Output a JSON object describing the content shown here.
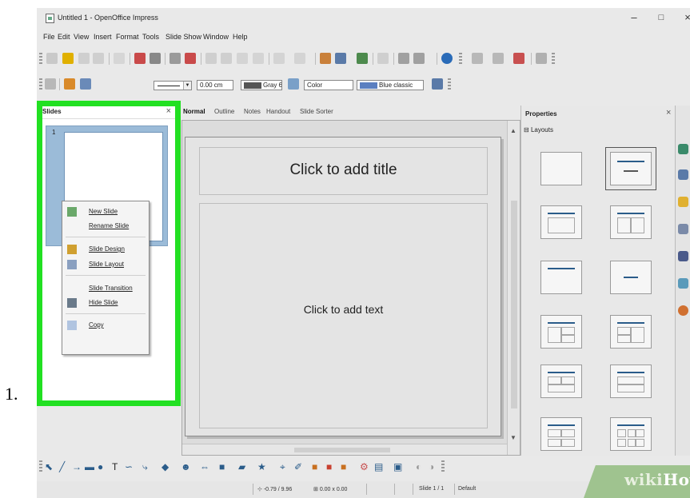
{
  "step_number": "1.",
  "window": {
    "title": "Untitled 1 - OpenOffice Impress",
    "minimize": "–",
    "maximize": "□",
    "close": "×"
  },
  "menu": [
    "File",
    "Edit",
    "View",
    "Insert",
    "Format",
    "Tools",
    "Slide Show",
    "Window",
    "Help"
  ],
  "line_toolbar": {
    "line_width": "0.00 cm",
    "line_color": "Gray 6",
    "area_style": "Color",
    "area_color": "Blue classic",
    "colors": {
      "gray": "#555555",
      "blue": "#5b7fc0"
    }
  },
  "slides_pane": {
    "title": "Slides",
    "close": "×",
    "slide_number": "1",
    "highlight_color": "#22e022"
  },
  "context_menu": {
    "items": [
      {
        "label": "New Slide",
        "icon": "new-slide-icon"
      },
      {
        "label": "Rename Slide",
        "icon": ""
      },
      {
        "label": "Slide Design",
        "icon": "slide-design-icon"
      },
      {
        "label": "Slide Layout",
        "icon": "slide-layout-icon"
      },
      {
        "label": "Slide Transition",
        "icon": ""
      },
      {
        "label": "Hide Slide",
        "icon": "hide-slide-icon"
      },
      {
        "label": "Copy",
        "icon": "copy-icon"
      }
    ]
  },
  "view_tabs": [
    "Normal",
    "Outline",
    "Notes",
    "Handout",
    "Slide Sorter"
  ],
  "slide": {
    "title_placeholder": "Click to add title",
    "body_placeholder": "Click to add text"
  },
  "properties": {
    "title": "Properties",
    "close": "×",
    "section": "Layouts",
    "section_toggle": "⊟"
  },
  "status_bar": {
    "position": "-0.79 / 9.96",
    "size": "0.00 x 0.00",
    "slide": "Slide 1 / 1",
    "master": "Default"
  },
  "watermark": {
    "prefix": "wiki",
    "suffix": "How",
    "color": "#9fc38f"
  }
}
